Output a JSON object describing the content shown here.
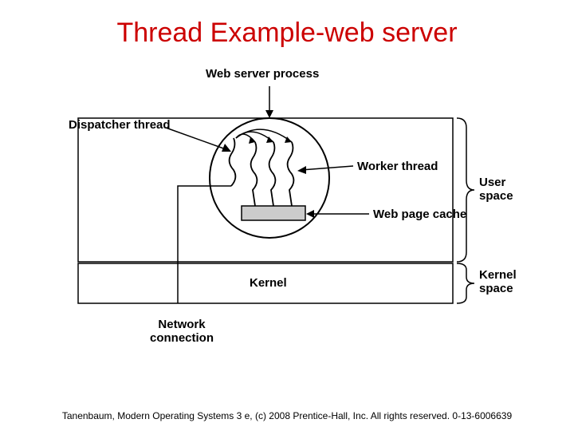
{
  "title": "Thread Example-web server",
  "labels": {
    "process": "Web server process",
    "dispatcher": "Dispatcher thread",
    "worker": "Worker thread",
    "cache": "Web page cache",
    "user_space": "User\nspace",
    "kernel_space": "Kernel\nspace",
    "kernel": "Kernel",
    "network": "Network\nconnection"
  },
  "footer": "Tanenbaum, Modern Operating Systems 3 e, (c) 2008 Prentice-Hall, Inc. All rights reserved. 0-13-6006639"
}
